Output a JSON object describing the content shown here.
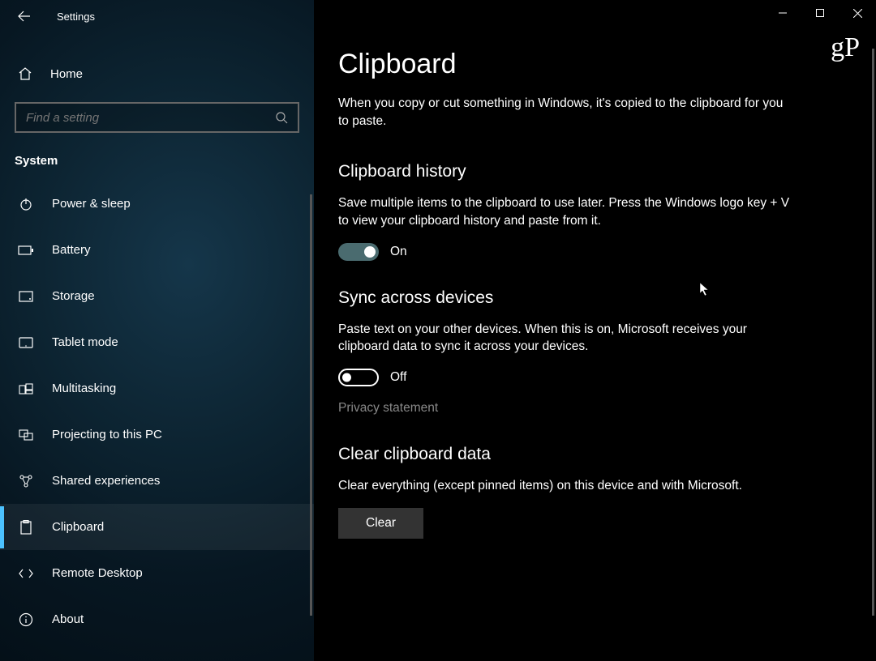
{
  "window": {
    "app_title": "Settings",
    "watermark": "gP"
  },
  "sidebar": {
    "home_label": "Home",
    "search_placeholder": "Find a setting",
    "category_label": "System",
    "items": [
      {
        "label": "Power & sleep",
        "icon": "power"
      },
      {
        "label": "Battery",
        "icon": "battery"
      },
      {
        "label": "Storage",
        "icon": "storage"
      },
      {
        "label": "Tablet mode",
        "icon": "tablet"
      },
      {
        "label": "Multitasking",
        "icon": "multitask"
      },
      {
        "label": "Projecting to this PC",
        "icon": "project"
      },
      {
        "label": "Shared experiences",
        "icon": "shared"
      },
      {
        "label": "Clipboard",
        "icon": "clipboard",
        "active": true
      },
      {
        "label": "Remote Desktop",
        "icon": "remote"
      },
      {
        "label": "About",
        "icon": "info"
      }
    ]
  },
  "main": {
    "page_title": "Clipboard",
    "page_desc": "When you copy or cut something in Windows, it's copied to the clipboard for you to paste.",
    "history": {
      "title": "Clipboard history",
      "desc": "Save multiple items to the clipboard to use later. Press the Windows logo key + V to view your clipboard history and paste from it.",
      "toggle_state": "on",
      "toggle_label": "On"
    },
    "sync": {
      "title": "Sync across devices",
      "desc": "Paste text on your other devices. When this is on, Microsoft receives your clipboard data to sync it across your devices.",
      "toggle_state": "off",
      "toggle_label": "Off",
      "privacy_link": "Privacy statement"
    },
    "clear": {
      "title": "Clear clipboard data",
      "desc": "Clear everything (except pinned items) on this device and with Microsoft.",
      "button_label": "Clear"
    }
  }
}
